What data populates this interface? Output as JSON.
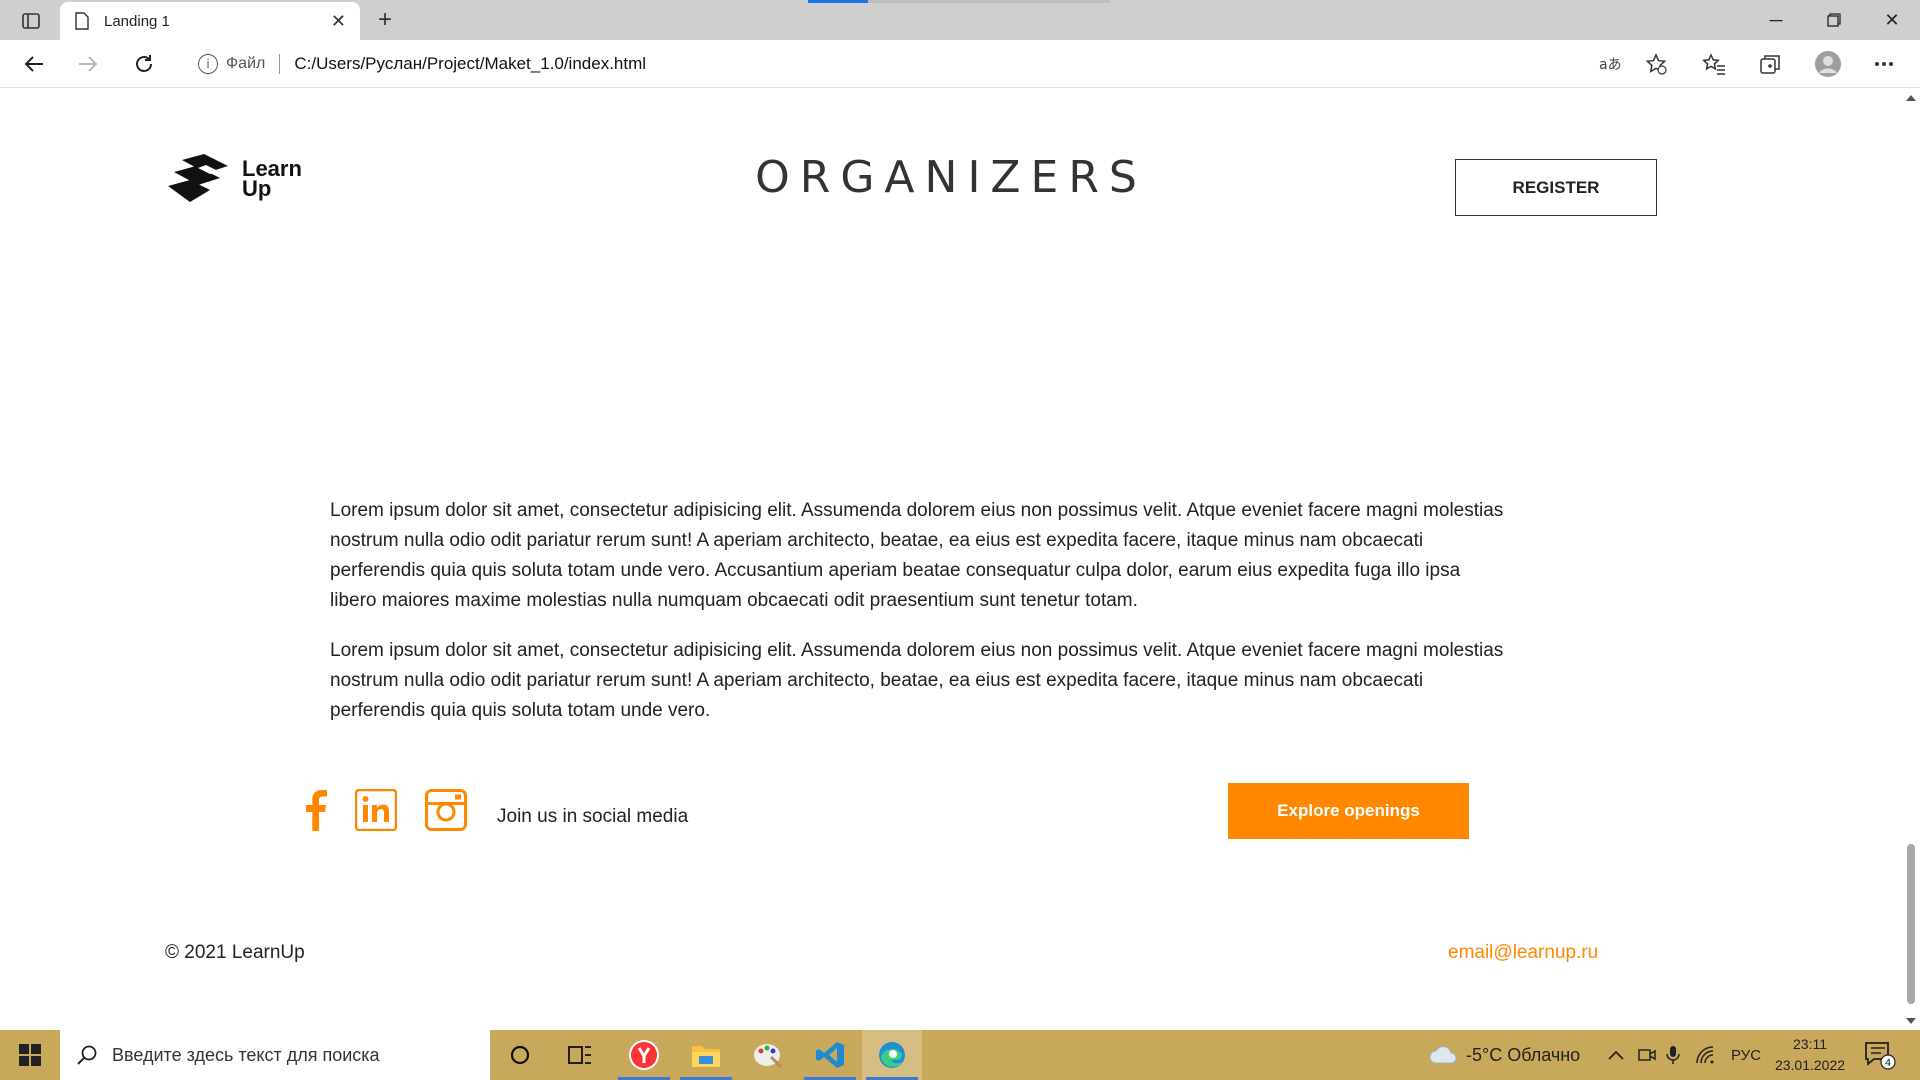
{
  "browser": {
    "tab_title": "Landing 1",
    "address_scheme": "Файл",
    "address_url": "C:/Users/Руслан/Project/Maket_1.0/index.html"
  },
  "page": {
    "logo_line1": "Learn",
    "logo_line2": "Up",
    "heading": "ORGANIZERS",
    "register_label": "REGISTER",
    "paragraphs": [
      "Lorem ipsum dolor sit amet, consectetur adipisicing elit. Assumenda dolorem eius non possimus velit. Atque eveniet facere magni molestias nostrum nulla odio odit pariatur rerum sunt! A aperiam architecto, beatae, ea eius est expedita facere, itaque minus nam obcaecati perferendis quia quis soluta totam unde vero. Accusantium aperiam beatae consequatur culpa dolor, earum eius expedita fuga illo ipsa libero maiores maxime molestias nulla numquam obcaecati odit praesentium sunt tenetur totam.",
      "Lorem ipsum dolor sit amet, consectetur adipisicing elit. Assumenda dolorem eius non possimus velit. Atque eveniet facere magni molestias nostrum nulla odio odit pariatur rerum sunt! A aperiam architecto, beatae, ea eius est expedita facere, itaque minus nam obcaecati perferendis quia quis soluta totam unde vero."
    ],
    "social_text": "Join us in social media",
    "explore_label": "Explore openings",
    "copyright": "© 2021 LearnUp",
    "email": "email@learnup.ru",
    "accent_color": "#ff8800"
  },
  "taskbar": {
    "search_placeholder": "Введите здесь текст для поиска",
    "weather": "-5°C Облачно",
    "language": "РУС",
    "time": "23:11",
    "date": "23.01.2022",
    "notification_count": "4"
  }
}
